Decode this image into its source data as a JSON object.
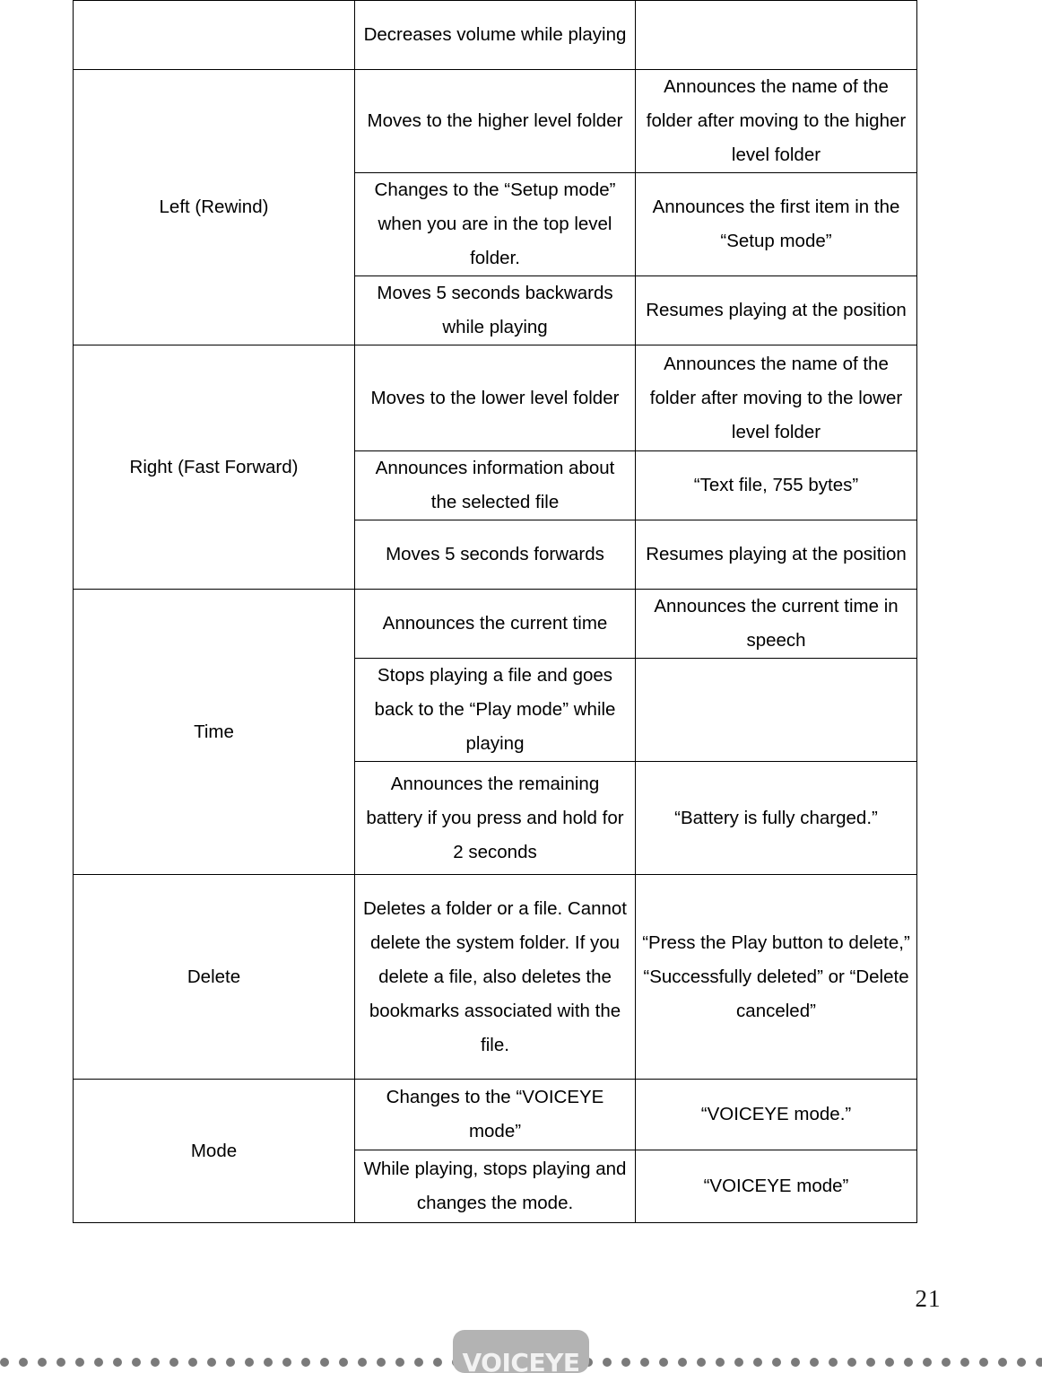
{
  "document": {
    "page_number": "21",
    "footer_logo_text": "VOICEYE",
    "colors": {
      "table_border": "#000000",
      "text": "#000000",
      "footer_dot": "#7a7a7a",
      "footer_logo_bg": "#b3b3b3",
      "footer_logo_text": "#f2f2f2"
    }
  },
  "table": {
    "rows": [
      {
        "key": "",
        "function": "Decreases volume while playing",
        "voice": ""
      },
      {
        "key": "Left (Rewind)",
        "function": "Moves to the higher level folder",
        "voice": "Announces the name of the folder after moving to the higher level folder"
      },
      {
        "key": "",
        "function": "Changes to the “Setup mode” when you are in the top level folder.",
        "voice": "Announces the first item in the “Setup mode”"
      },
      {
        "key": "",
        "function": "Moves 5 seconds backwards while playing",
        "voice": "Resumes playing at the position"
      },
      {
        "key": "Right (Fast Forward)",
        "function": "Moves to the lower level folder",
        "voice": "Announces the name of the folder after moving to the lower level folder"
      },
      {
        "key": "",
        "function": "Announces information about the selected file",
        "voice": "“Text file, 755 bytes”"
      },
      {
        "key": "",
        "function": "Moves 5 seconds forwards",
        "voice": "Resumes playing at the position"
      },
      {
        "key": "Time",
        "function": "Announces the current time",
        "voice": "Announces the current time in speech"
      },
      {
        "key": "",
        "function": "Stops playing a file and goes back to the “Play mode” while playing",
        "voice": ""
      },
      {
        "key": "",
        "function": "Announces the remaining battery if you press and hold for 2 seconds",
        "voice": "“Battery is fully charged.”"
      },
      {
        "key": "Delete",
        "function": "Deletes a folder or a file. Cannot delete the system folder. If you delete a file, also deletes the bookmarks associated with the file.",
        "voice": "“Press the Play button to delete,” “Successfully deleted” or “Delete canceled”"
      },
      {
        "key": "",
        "function": "Changes to the “VOICEYE mode”",
        "voice": "“VOICEYE mode.”"
      },
      {
        "key": "Mode",
        "function": "While playing, stops playing and changes the mode.",
        "voice": "“VOICEYE mode”"
      }
    ]
  }
}
